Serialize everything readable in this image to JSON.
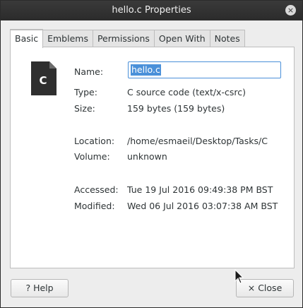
{
  "window": {
    "title": "hello.c Properties",
    "close_glyph": "×"
  },
  "tabs": [
    {
      "label": "Basic",
      "active": true
    },
    {
      "label": "Emblems"
    },
    {
      "label": "Permissions"
    },
    {
      "label": "Open With"
    },
    {
      "label": "Notes"
    }
  ],
  "file_icon": {
    "icon": "c-source-file-icon",
    "letter": "C"
  },
  "fields": {
    "name": {
      "label": "Name:",
      "value": "hello.c"
    },
    "type": {
      "label": "Type:",
      "value": "C source code (text/x-csrc)"
    },
    "size": {
      "label": "Size:",
      "value": "159 bytes (159 bytes)"
    },
    "location": {
      "label": "Location:",
      "value": "/home/esmaeil/Desktop/Tasks/C"
    },
    "volume": {
      "label": "Volume:",
      "value": "unknown"
    },
    "accessed": {
      "label": "Accessed:",
      "value": "Tue 19 Jul 2016 09:49:38 PM BST"
    },
    "modified": {
      "label": "Modified:",
      "value": "Wed 06 Jul 2016 03:07:38 AM BST"
    }
  },
  "buttons": {
    "help": {
      "label": "Help",
      "icon": "question-icon",
      "glyph": "?"
    },
    "close": {
      "label": "Close",
      "icon": "close-icon",
      "glyph": "×"
    }
  },
  "colors": {
    "selection": "#4a90d9",
    "titlebar": "#2b2b2b"
  }
}
